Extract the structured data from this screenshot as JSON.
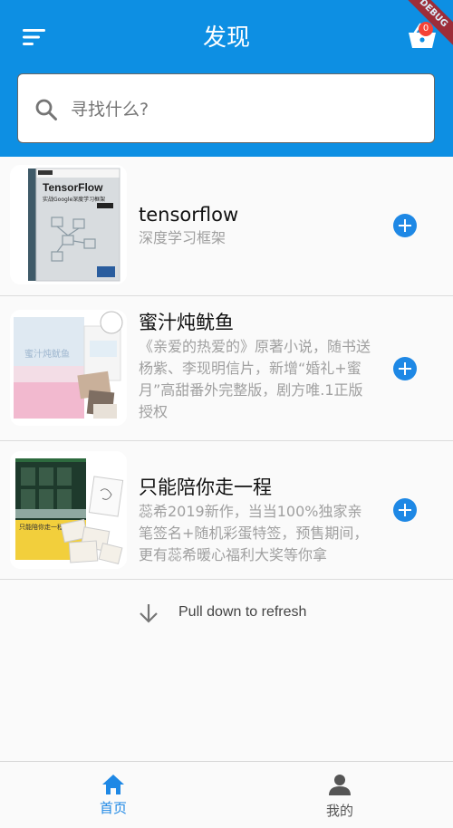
{
  "app_bar": {
    "title": "发现",
    "menu_icon": "sort-menu-icon",
    "cart_icon": "shopping-basket-icon",
    "cart_badge": "0",
    "debug_banner": "DEBUG",
    "color": "#0d8fe3"
  },
  "search": {
    "placeholder": "寻找什么?",
    "icon": "search-icon"
  },
  "items": [
    {
      "title": "tensorflow",
      "description": "深度学习框架",
      "cover_title": "TensorFlow",
      "cover_subtitle": "实战Google深度学习框架"
    },
    {
      "title": "蜜汁炖鱿鱼",
      "description": "《亲爱的热爱的》原著小说，随书送杨紫、李现明信片，新增“婚礼+蜜月”高甜番外完整版，剧方唯.1正版授权",
      "cover_title": "蜜汁炖鱿鱼"
    },
    {
      "title": "只能陪你走一程",
      "description": "蕊希2019新作，当当100%独家亲笔签名+随机彩蛋特签，预售期间，更有蕊希暖心福利大奖等你拿",
      "cover_title": "只能陪你走一程"
    }
  ],
  "refresh": {
    "text": "Pull down to refresh",
    "icon": "arrow-down-icon"
  },
  "bottom_nav": {
    "home_label": "首页",
    "mine_label": "我的",
    "active_color": "#1e88e5",
    "inactive_color": "#555555"
  }
}
